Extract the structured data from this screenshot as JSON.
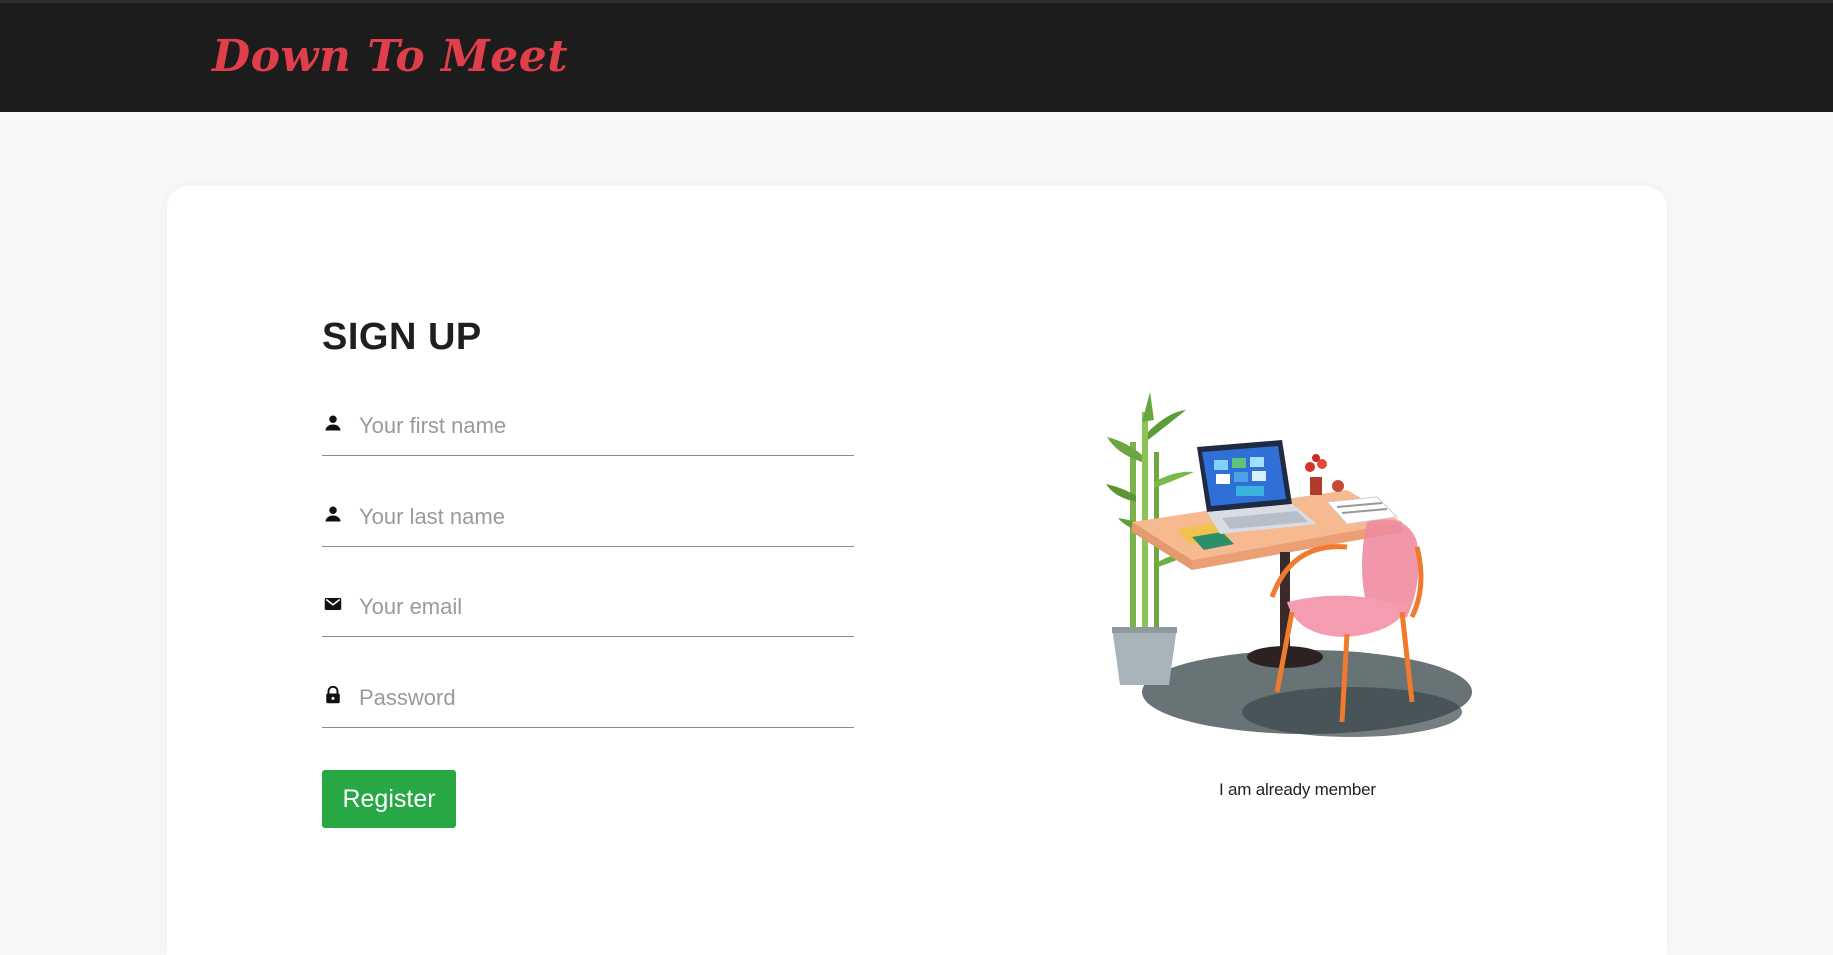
{
  "header": {
    "brand": "Down To Meet",
    "brand_color": "#e03e4a",
    "background": "#1c1c1c"
  },
  "signup": {
    "title": "SIGN UP",
    "fields": [
      {
        "icon": "person-icon",
        "placeholder": "Your first name",
        "value": ""
      },
      {
        "icon": "person-icon",
        "placeholder": "Your last name",
        "value": ""
      },
      {
        "icon": "mail-icon",
        "placeholder": "Your email",
        "value": ""
      },
      {
        "icon": "lock-icon",
        "placeholder": "Password",
        "value": ""
      }
    ],
    "register_label": "Register",
    "register_color": "#28a745"
  },
  "aside": {
    "illustration": "desk-with-laptop-and-chair",
    "member_link": "I am already member"
  }
}
